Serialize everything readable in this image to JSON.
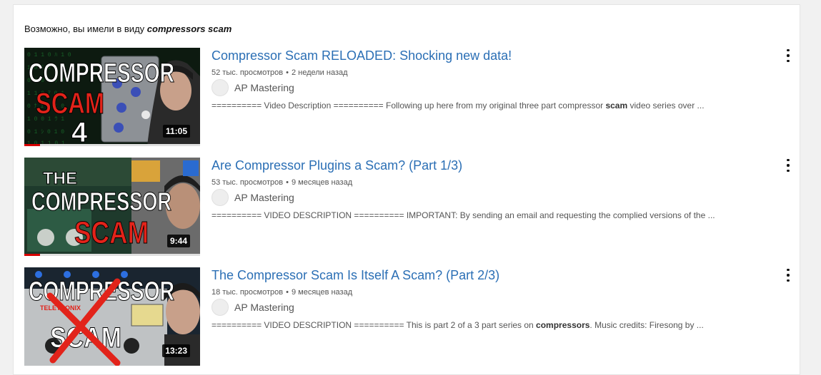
{
  "suggestion": {
    "prefix": "Возможно, вы имели в виду ",
    "query": "compressors scam"
  },
  "videos": [
    {
      "title": "Compressor Scam RELOADED: Shocking new data!",
      "views": "52 тыс. просмотров",
      "age": "2 недели назад",
      "channel": "AP Mastering",
      "description_before": "========== Video Description ========== Following up here from my original three part compressor ",
      "description_bold": "scam",
      "description_after": " video series over ...",
      "duration": "11:05",
      "thumb_lines": [
        "COMPRESSOR",
        "SCAM",
        "4"
      ],
      "watched_fraction": 0.09
    },
    {
      "title": "Are Compressor Plugins a Scam? (Part 1/3)",
      "views": "53 тыс. просмотров",
      "age": "9 месяцев назад",
      "channel": "AP Mastering",
      "description_before": "========== VIDEO DESCRIPTION ========== IMPORTANT: By sending an email and requesting the complied versions of the ...",
      "description_bold": "",
      "description_after": "",
      "duration": "9:44",
      "thumb_lines": [
        "THE",
        "COMPRESSOR",
        "SCAM"
      ],
      "watched_fraction": 0.09
    },
    {
      "title": "The Compressor Scam Is Itself A Scam? (Part 2/3)",
      "views": "18 тыс. просмотров",
      "age": "9 месяцев назад",
      "channel": "AP Mastering",
      "description_before": "========== VIDEO DESCRIPTION ========== This is part 2 of a 3 part series on ",
      "description_bold": "compressors",
      "description_after": ". Music credits: Firesong by ...",
      "duration": "13:23",
      "thumb_lines": [
        "COMPRESSOR",
        "SCAM",
        "TELETRONIX"
      ],
      "watched_fraction": 0
    }
  ],
  "dot_separator": "•",
  "colors": {
    "title_link": "#2b6fb5",
    "thumb_red": "#e2231a",
    "progress_red": "#d70000"
  }
}
